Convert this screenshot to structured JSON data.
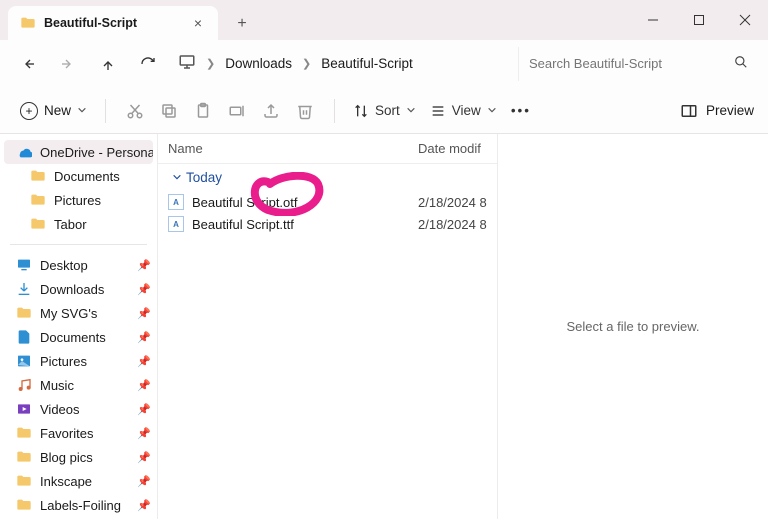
{
  "tab": {
    "title": "Beautiful-Script"
  },
  "window_controls": {
    "min": "minimize",
    "max": "maximize",
    "close": "close"
  },
  "address": {
    "crumbs": [
      "Downloads",
      "Beautiful-Script"
    ]
  },
  "search": {
    "placeholder": "Search Beautiful-Script"
  },
  "toolbar": {
    "new_label": "New",
    "sort_label": "Sort",
    "view_label": "View",
    "preview_label": "Preview"
  },
  "sidebar": {
    "onedrive": "OneDrive - Persona",
    "onedrive_children": [
      "Documents",
      "Pictures",
      "Tabor"
    ],
    "quick": [
      {
        "label": "Desktop",
        "icon": "desktop",
        "color": "#2f8fd3"
      },
      {
        "label": "Downloads",
        "icon": "download",
        "color": "#2f8fd3"
      },
      {
        "label": "My SVG's",
        "icon": "folder",
        "color": "#f5c96b"
      },
      {
        "label": "Documents",
        "icon": "document",
        "color": "#2f8fd3"
      },
      {
        "label": "Pictures",
        "icon": "pictures",
        "color": "#2f8fd3"
      },
      {
        "label": "Music",
        "icon": "music",
        "color": "#d46b3e"
      },
      {
        "label": "Videos",
        "icon": "video",
        "color": "#7a3fbf"
      },
      {
        "label": "Favorites",
        "icon": "folder",
        "color": "#f5c96b"
      },
      {
        "label": "Blog pics",
        "icon": "folder",
        "color": "#f5c96b"
      },
      {
        "label": "Inkscape",
        "icon": "folder",
        "color": "#f5c96b"
      },
      {
        "label": "Labels-Foiling",
        "icon": "folder",
        "color": "#f5c96b"
      }
    ]
  },
  "columns": {
    "name": "Name",
    "date": "Date modif"
  },
  "group": {
    "label": "Today"
  },
  "files": [
    {
      "name": "Beautiful Script.otf",
      "date": "2/18/2024 8"
    },
    {
      "name": "Beautiful Script.ttf",
      "date": "2/18/2024 8"
    }
  ],
  "preview": {
    "empty": "Select a file to preview."
  }
}
